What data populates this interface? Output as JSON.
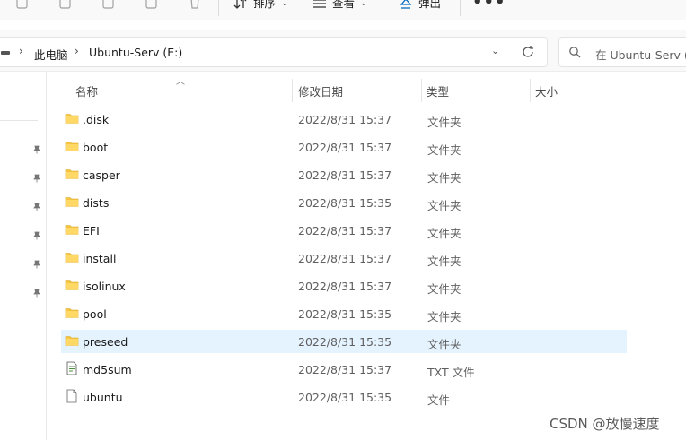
{
  "toolbar": {
    "sort_label": "排序",
    "view_label": "查看",
    "eject_label": "弹出",
    "more_label": "•••"
  },
  "address": {
    "breadcrumbs": [
      "此电脑",
      "Ubuntu-Serv (E:)"
    ],
    "separator": "›"
  },
  "search": {
    "placeholder": "在 Ubuntu-Serv (E:)"
  },
  "columns": {
    "name": "名称",
    "date": "修改日期",
    "type": "类型",
    "size": "大小"
  },
  "files": [
    {
      "name": ".disk",
      "date": "2022/8/31 15:37",
      "type": "文件夹",
      "icon": "folder-icon"
    },
    {
      "name": "boot",
      "date": "2022/8/31 15:37",
      "type": "文件夹",
      "icon": "folder-icon"
    },
    {
      "name": "casper",
      "date": "2022/8/31 15:37",
      "type": "文件夹",
      "icon": "folder-icon"
    },
    {
      "name": "dists",
      "date": "2022/8/31 15:35",
      "type": "文件夹",
      "icon": "folder-icon"
    },
    {
      "name": "EFI",
      "date": "2022/8/31 15:37",
      "type": "文件夹",
      "icon": "folder-icon"
    },
    {
      "name": "install",
      "date": "2022/8/31 15:37",
      "type": "文件夹",
      "icon": "folder-icon"
    },
    {
      "name": "isolinux",
      "date": "2022/8/31 15:37",
      "type": "文件夹",
      "icon": "folder-icon"
    },
    {
      "name": "pool",
      "date": "2022/8/31 15:35",
      "type": "文件夹",
      "icon": "folder-icon"
    },
    {
      "name": "preseed",
      "date": "2022/8/31 15:35",
      "type": "文件夹",
      "icon": "folder-icon",
      "selected": true
    },
    {
      "name": "md5sum",
      "date": "2022/8/31 15:37",
      "type": "TXT 文件",
      "icon": "text-file-icon"
    },
    {
      "name": "ubuntu",
      "date": "2022/8/31 15:35",
      "type": "文件",
      "icon": "file-icon"
    }
  ],
  "watermark": "CSDN @放慢速度",
  "colors": {
    "selected_row": "#e5f3ff",
    "folder": "#f5c542",
    "accent": "#0067c0"
  }
}
